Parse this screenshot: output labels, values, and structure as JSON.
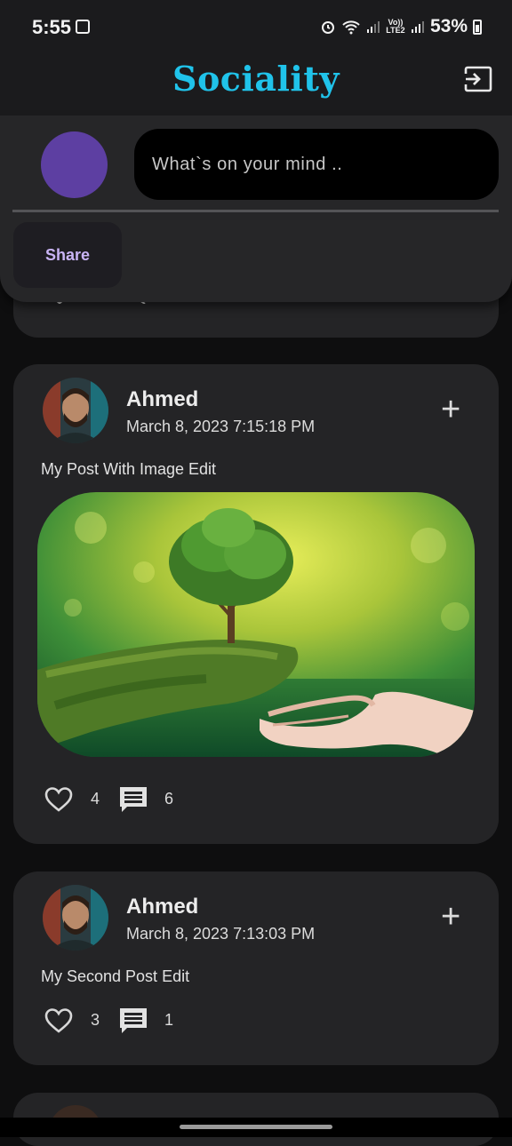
{
  "status_bar": {
    "time": "5:55",
    "signal_label": "Vo)) LTE2",
    "battery": "53%"
  },
  "app": {
    "title": "Sociality",
    "accent": "#20c3ea"
  },
  "composer": {
    "placeholder": "What`s on your mind ..",
    "share_label": "Share",
    "avatar_color": "#5d3fa2"
  },
  "posts": [
    {
      "author": "Ahmed",
      "date": "March 8, 2023 7:15:18 PM",
      "text": "My Post With Image Edit",
      "has_image": true,
      "image_alt": "Hand holding a small tree",
      "likes": "4",
      "comments": "6"
    },
    {
      "author": "Ahmed",
      "date": "March 8, 2023 7:13:03 PM",
      "text": "My Second Post Edit",
      "has_image": false,
      "likes": "3",
      "comments": "1"
    }
  ]
}
